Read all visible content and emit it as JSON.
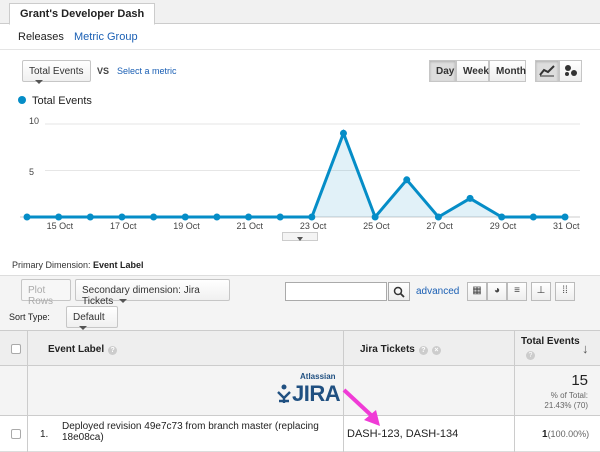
{
  "tab": {
    "title": "Grant's Developer Dash"
  },
  "subnav": {
    "releases": "Releases",
    "metric_group": "Metric Group"
  },
  "controls": {
    "metric_select": "Total Events",
    "vs": "VS",
    "select_metric": "Select a metric",
    "day": "Day",
    "week": "Week",
    "month": "Month"
  },
  "legend": {
    "label": "Total Events"
  },
  "chart_data": {
    "type": "line",
    "series": [
      {
        "name": "Total Events",
        "color": "#058dc7",
        "values": [
          0,
          0,
          0,
          0,
          0,
          0,
          0,
          0,
          0,
          0,
          9,
          0,
          4,
          0,
          2,
          0,
          0,
          0
        ]
      }
    ],
    "x_ticks": [
      "15 Oct",
      "17 Oct",
      "19 Oct",
      "21 Oct",
      "23 Oct",
      "25 Oct",
      "27 Oct",
      "29 Oct",
      "31 Oct"
    ],
    "y_ticks": [
      "10",
      "5"
    ],
    "ylim": [
      0,
      10
    ]
  },
  "dimension": {
    "label": "Primary Dimension:",
    "value": "Event Label"
  },
  "toolbar": {
    "plot_rows": "Plot Rows",
    "secondary": "Secondary dimension: Jira Tickets",
    "advanced": "advanced"
  },
  "sort": {
    "label": "Sort Type:",
    "value": "Default"
  },
  "table": {
    "col_event": "Event Label",
    "col_jira": "Jira Tickets",
    "col_total": "Total Events",
    "summary_total": "15",
    "summary_pct": "% of Total:",
    "summary_pct_value": "21.43% (70)",
    "jira_logo_top": "Atlassian",
    "jira_logo": "JIRA",
    "row_index": "1.",
    "row_label": "Deployed revision 49e7c73 from branch master (replacing 18e08ca)",
    "row_jira": "DASH-123, DASH-134",
    "row_total": "1",
    "row_pct": "(100.00%)"
  },
  "colors": {
    "accent": "#058dc7",
    "arrow": "#f03bd6",
    "link": "#1a5fb4",
    "jira": "#205081"
  }
}
